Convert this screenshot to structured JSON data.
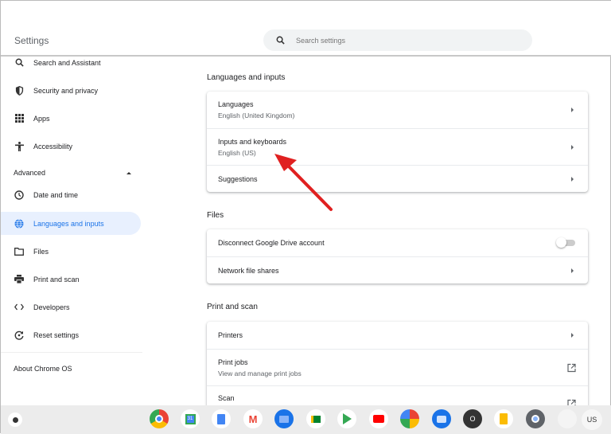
{
  "header": {
    "title": "Settings",
    "search_placeholder": "Search settings"
  },
  "sidebar": {
    "items": [
      {
        "label": "Search and Assistant",
        "icon": "search-icon"
      },
      {
        "label": "Security and privacy",
        "icon": "shield-icon"
      },
      {
        "label": "Apps",
        "icon": "apps-grid-icon"
      },
      {
        "label": "Accessibility",
        "icon": "accessibility-icon"
      }
    ],
    "advanced_label": "Advanced",
    "advanced_items": [
      {
        "label": "Date and time",
        "icon": "clock-icon"
      },
      {
        "label": "Languages and inputs",
        "icon": "globe-icon",
        "active": true
      },
      {
        "label": "Files",
        "icon": "folder-icon"
      },
      {
        "label": "Print and scan",
        "icon": "printer-icon"
      },
      {
        "label": "Developers",
        "icon": "code-icon"
      },
      {
        "label": "Reset settings",
        "icon": "reset-icon"
      }
    ],
    "about": "About Chrome OS"
  },
  "main": {
    "languages": {
      "title": "Languages and inputs",
      "rows": [
        {
          "label": "Languages",
          "sub": "English (United Kingdom)"
        },
        {
          "label": "Inputs and keyboards",
          "sub": "English (US)"
        },
        {
          "label": "Suggestions"
        }
      ]
    },
    "files": {
      "title": "Files",
      "rows": [
        {
          "label": "Disconnect Google Drive account",
          "toggle": false
        },
        {
          "label": "Network file shares"
        }
      ]
    },
    "print": {
      "title": "Print and scan",
      "rows": [
        {
          "label": "Printers"
        },
        {
          "label": "Print jobs",
          "sub": "View and manage print jobs"
        },
        {
          "label": "Scan"
        }
      ]
    }
  },
  "annotation": {
    "arrow_color": "#e02020"
  },
  "shelf": {
    "apps": [
      "chrome",
      "calendar",
      "docs",
      "gmail",
      "files",
      "meet",
      "play-store",
      "youtube",
      "photos",
      "messages",
      "o-app",
      "keep",
      "settings",
      "blank-app"
    ],
    "user_label": "US",
    "circle_app_label": "O",
    "calendar_label": "31"
  },
  "colors": {
    "accent": "#1a73e8",
    "active_bg": "#e8f0fe"
  }
}
